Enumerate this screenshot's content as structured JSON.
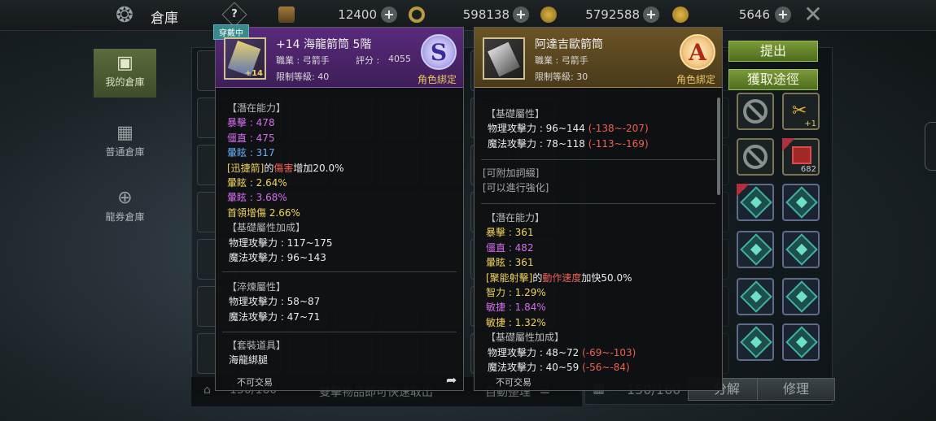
{
  "header": {
    "title": "倉庫",
    "help_icon": "?",
    "currencies": [
      {
        "icon": "ticket-icon",
        "value": "12400"
      },
      {
        "icon": "gold-ring-icon",
        "value": "598138"
      },
      {
        "icon": "coin-pouch-icon",
        "value": "5792588"
      },
      {
        "icon": "coin-icon",
        "value": "5646"
      }
    ]
  },
  "nav": {
    "items": [
      {
        "label": "我的倉庫",
        "icon": "box-icon",
        "active": true
      },
      {
        "label": "普通倉庫",
        "icon": "building-icon",
        "active": false
      },
      {
        "label": "龍券倉庫",
        "icon": "coupon-icon",
        "active": false
      }
    ]
  },
  "storage": {
    "count": "150/160",
    "hint": "雙擊物品即可快速取出",
    "auto_sort": "自動整理"
  },
  "inventory": {
    "count": "150/160",
    "withdraw_label": "提出",
    "obtain_label": "獲取途徑",
    "disassemble_label": "分解",
    "repair_label": "修理",
    "slot_counts": [
      "+1",
      "682"
    ]
  },
  "tooltip_equipped": {
    "tag": "穿戴中",
    "name": "+14 海龍箭筒 5階",
    "enhance": "+14",
    "class_line": "職業 : 弓箭手",
    "score_label": "評分 :",
    "score": "4055",
    "level": "限制等級: 40",
    "grade": "S",
    "bind": "角色綁定",
    "potential_title": "【潛在能力】",
    "potential": [
      {
        "text": "暴擊 : 478",
        "color": "purple"
      },
      {
        "text": "僵直 : 475",
        "color": "purple"
      },
      {
        "text": "暈眩 : 317",
        "color": "blue"
      },
      {
        "pre": "[迅捷箭]",
        "mid": "的",
        "hl": "傷害",
        "post": "增加20.0%"
      },
      {
        "text": "暈眩 : 2.64%",
        "color": "yellow"
      },
      {
        "text": "暈眩 : 3.68%",
        "color": "purple"
      },
      {
        "text": "首領增傷 2.66%",
        "color": "yellow"
      }
    ],
    "base_bonus_title": "【基礎屬性加成】",
    "base_bonus": [
      "物理攻擊力 : 117~175",
      "魔法攻擊力 : 96~143"
    ],
    "temper_title": "【淬煉屬性】",
    "temper": [
      "物理攻擊力 : 58~87",
      "魔法攻擊力 : 47~71"
    ],
    "set_title": "【套裝道具】",
    "set_item": "海龍綁腿",
    "trade": "不可交易"
  },
  "tooltip_compare": {
    "name": "阿達吉歐箭筒",
    "class_line": "職業 : 弓箭手",
    "level": "限制等級: 30",
    "grade": "A",
    "bind": "角色綁定",
    "base_title": "【基礎屬性】",
    "base": [
      {
        "text": "物理攻擊力 : 96~144",
        "diff": "(-138~-207)"
      },
      {
        "text": "魔法攻擊力 : 78~118",
        "diff": "(-113~-169)"
      }
    ],
    "extra_title": "[可附加詞綴]",
    "enhance_note": "[可以進行強化]",
    "potential_title": "【潛在能力】",
    "potential": [
      {
        "text": "暴擊 : 361",
        "color": "yellow"
      },
      {
        "text": "僵直 : 482",
        "color": "purple"
      },
      {
        "text": "暈眩 : 361",
        "color": "yellow"
      },
      {
        "pre": "[聚能射擊]",
        "mid": "的",
        "hl": "動作速度",
        "post": "加快50.0%"
      },
      {
        "text": "智力 : 1.29%",
        "color": "yellow"
      },
      {
        "text": "敏捷 : 1.84%",
        "color": "purple"
      },
      {
        "text": "敏捷 : 1.32%",
        "color": "yellow"
      }
    ],
    "bonus_title": "【基礎屬性加成】",
    "bonus": [
      {
        "text": "物理攻擊力 : 48~72",
        "diff": "(-69~-103)"
      },
      {
        "text": "魔法攻擊力 : 40~59",
        "diff": "(-56~-84)"
      }
    ],
    "trade": "不可交易"
  },
  "colors": {
    "purple": "#d76cf0",
    "blue": "#6ab0ff",
    "yellow": "#f2d45a",
    "red": "#f06050",
    "bind_gold": "#e8c660",
    "active_nav": "#5a6b3c"
  }
}
